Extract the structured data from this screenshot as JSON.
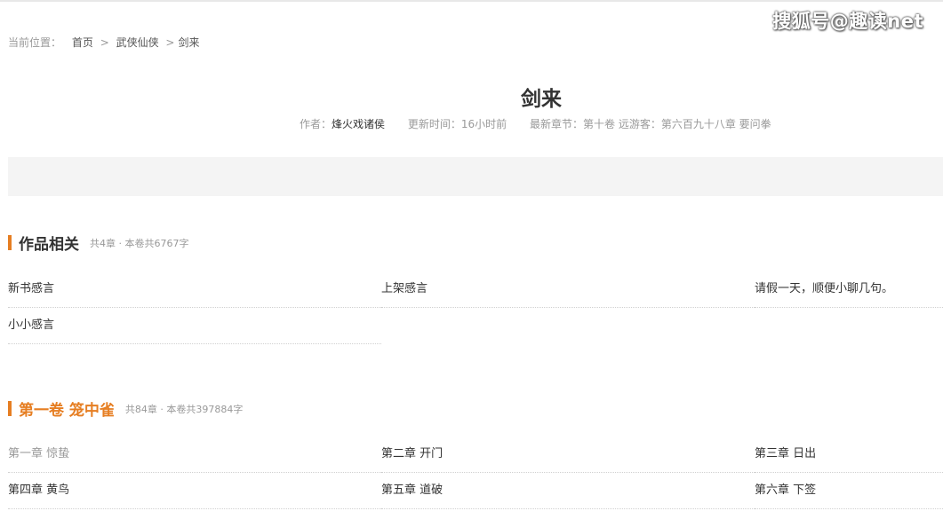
{
  "watermark": "搜狐号@趣读net",
  "breadcrumb": {
    "label": "当前位置：",
    "home": "首页",
    "sep1": ">",
    "category": "武侠仙侠",
    "sep2": ">",
    "current": "剑来"
  },
  "book": {
    "title": "剑来",
    "author_label": "作者：",
    "author": "烽火戏诸侯",
    "updated_label": "更新时间：",
    "updated": "16小时前",
    "latest_label": "最新章节：",
    "latest": "第十卷 远游客：第六百九十八章 要问拳"
  },
  "volumes": [
    {
      "title": "作品相关",
      "info": "共4章 · 本卷共6767字",
      "chapters": [
        {
          "title": "新书感言",
          "read": false
        },
        {
          "title": "上架感言",
          "read": false
        },
        {
          "title": "请假一天，顺便小聊几句。",
          "read": false
        },
        {
          "title": "小小感言",
          "read": false
        }
      ]
    },
    {
      "title": "第一卷 笼中雀",
      "info": "共84章 · 本卷共397884字",
      "chapters": [
        {
          "title": "第一章 惊蛰",
          "read": true
        },
        {
          "title": "第二章 开门",
          "read": false
        },
        {
          "title": "第三章 日出",
          "read": false
        },
        {
          "title": "第四章 黄鸟",
          "read": false
        },
        {
          "title": "第五章 道破",
          "read": false
        },
        {
          "title": "第六章 下签",
          "read": false
        }
      ]
    }
  ],
  "colors": {
    "accent": "#e67e22",
    "muted_text": "#999999",
    "body_text": "#333333",
    "band": "#f4f4f4"
  }
}
